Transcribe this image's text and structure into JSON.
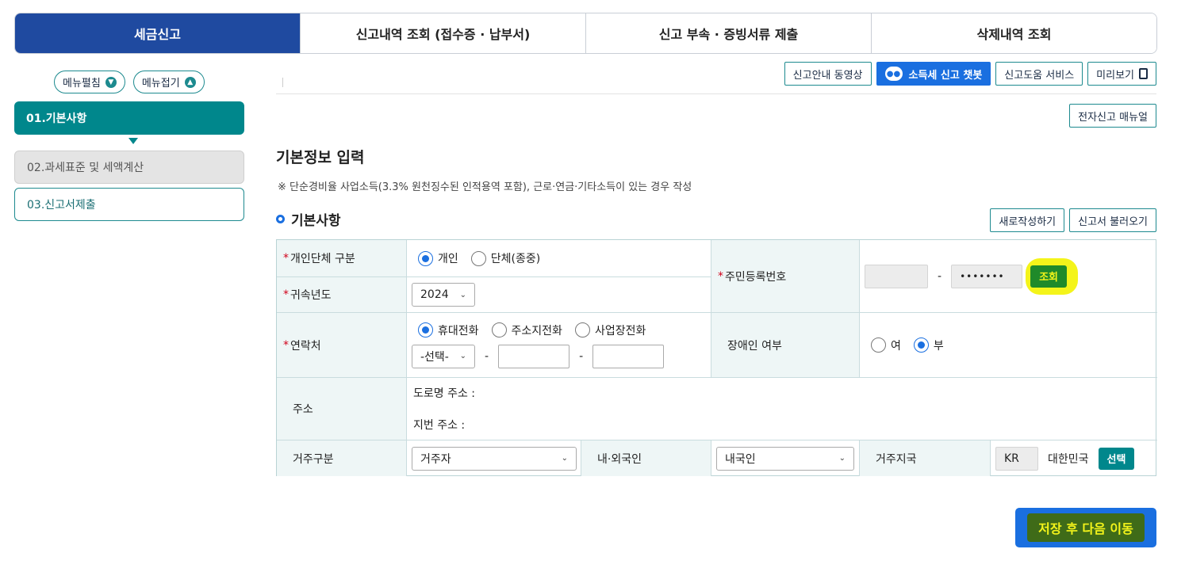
{
  "tabs": [
    "세금신고",
    "신고내역 조회 (접수증 · 납부서)",
    "신고 부속 · 증빙서류 제출",
    "삭제내역 조회"
  ],
  "sidebar": {
    "expand_label": "메뉴펼침",
    "collapse_label": "메뉴접기",
    "steps": [
      "01.기본사항",
      "02.과세표준 및 세액계산",
      "03.신고서제출"
    ]
  },
  "toolbar": {
    "video": "신고안내 동영상",
    "chatbot": "소득세 신고 챗봇",
    "help": "신고도움 서비스",
    "preview": "미리보기",
    "manual": "전자신고 매뉴얼"
  },
  "section": {
    "title": "기본정보 입력",
    "note": "※ 단순경비율 사업소득(3.3% 원천징수된 인적용역 포함), 근로·연금·기타소득이 있는 경우 작성",
    "subtitle": "기본사항",
    "new_btn": "새로작성하기",
    "load_btn": "신고서 불러오기"
  },
  "form": {
    "type_label": "개인단체 구분",
    "type_opt1": "개인",
    "type_opt2": "단체(종중)",
    "year_label": "귀속년도",
    "year_value": "2024",
    "rrn_label": "주민등록번호",
    "rrn_back": "•••••••",
    "rrn_dash": "-",
    "lookup_btn": "조회",
    "contact_label": "연락처",
    "contact_opt1": "휴대전화",
    "contact_opt2": "주소지전화",
    "contact_opt3": "사업장전화",
    "phone_select": "-선택-",
    "disabled_label": "장애인 여부",
    "disabled_yes": "여",
    "disabled_no": "부",
    "address_label": "주소",
    "road_address": "도로명 주소 :",
    "lot_address": "지번 주소 :",
    "residence_label": "거주구분",
    "residence_value": "거주자",
    "nationality_label": "내·외국인",
    "nationality_value": "내국인",
    "region_label": "거주지국",
    "region_code": "KR",
    "region_name": "대한민국",
    "select_btn": "선택"
  },
  "save_next": "저장 후 다음 이동"
}
